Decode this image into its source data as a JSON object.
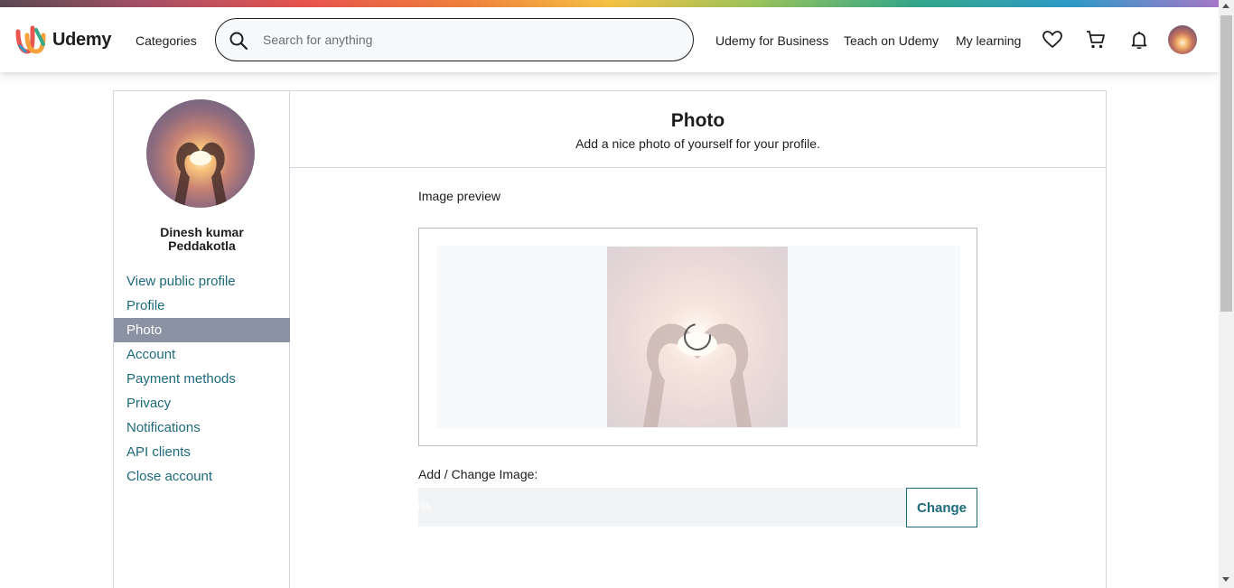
{
  "header": {
    "logo_text": "Udemy",
    "categories": "Categories",
    "search_placeholder": "Search for anything",
    "nav": {
      "business": "Udemy for Business",
      "teach": "Teach on Udemy",
      "my_learning": "My learning"
    },
    "icons": [
      "heart-icon",
      "cart-icon",
      "bell-icon"
    ]
  },
  "sidebar": {
    "user_name": "Dinesh kumar Peddakotla",
    "items": [
      {
        "label": "View public profile"
      },
      {
        "label": "Profile"
      },
      {
        "label": "Photo",
        "active": true
      },
      {
        "label": "Account"
      },
      {
        "label": "Payment methods"
      },
      {
        "label": "Privacy"
      },
      {
        "label": "Notifications"
      },
      {
        "label": "API clients"
      },
      {
        "label": "Close account"
      }
    ]
  },
  "main": {
    "title": "Photo",
    "subtitle": "Add a nice photo of yourself for your profile.",
    "preview_label": "Image preview",
    "change_label": "Add / Change Image:",
    "progress_text": "0%",
    "change_button": "Change"
  },
  "colors": {
    "link": "#1e6a7a",
    "active_bg": "#8a92a3",
    "border": "#d1d7dc"
  }
}
